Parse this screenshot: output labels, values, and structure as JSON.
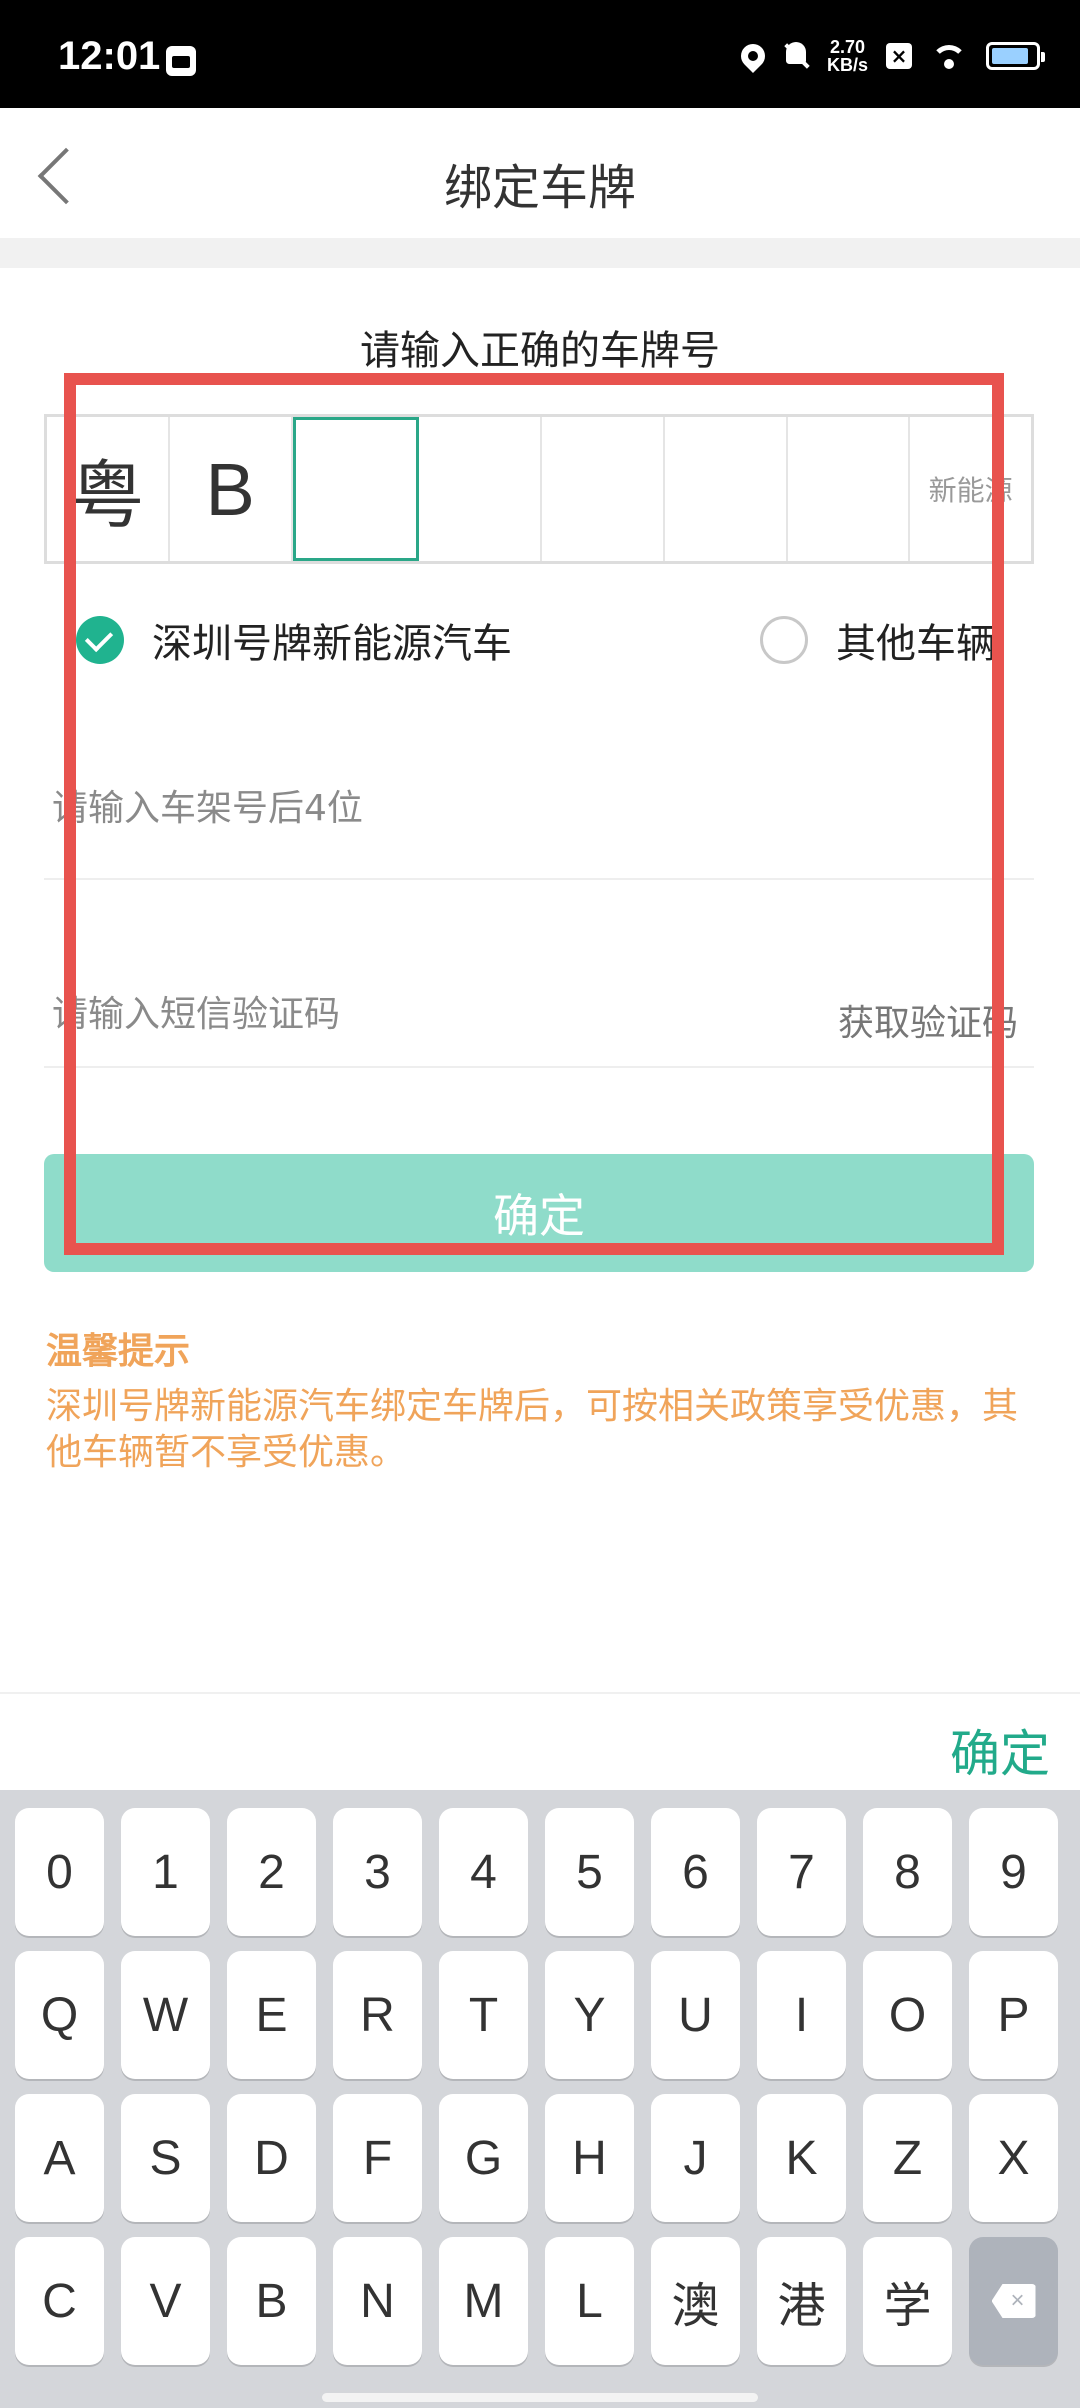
{
  "status_bar": {
    "time": "12:01",
    "speed": "2.70\nKB/s",
    "battery_level": 0.85
  },
  "header": {
    "title": "绑定车牌"
  },
  "form": {
    "heading": "请输入正确的车牌号",
    "plate_cells": [
      "粤",
      "B",
      "",
      "",
      "",
      "",
      "",
      "新能源"
    ],
    "radio_options": [
      {
        "label": "深圳号牌新能源汽车",
        "selected": true
      },
      {
        "label": "其他车辆",
        "selected": false
      }
    ],
    "vin_placeholder": "请输入车架号后4位",
    "sms_placeholder": "请输入短信验证码",
    "get_code_label": "获取验证码",
    "confirm_label": "确定"
  },
  "tips": {
    "title": "温馨提示",
    "body": "深圳号牌新能源汽车绑定车牌后，可按相关政策享受优惠，其他车辆暂不享受优惠。"
  },
  "keyboard": {
    "done_label": "确定",
    "rows": [
      [
        "0",
        "1",
        "2",
        "3",
        "4",
        "5",
        "6",
        "7",
        "8",
        "9"
      ],
      [
        "Q",
        "W",
        "E",
        "R",
        "T",
        "Y",
        "U",
        "I",
        "O",
        "P"
      ],
      [
        "A",
        "S",
        "D",
        "F",
        "G",
        "H",
        "J",
        "K",
        "Z",
        "X"
      ],
      [
        "C",
        "V",
        "B",
        "N",
        "M",
        "L",
        "澳",
        "港",
        "学"
      ]
    ],
    "delete_icon": "backspace-icon"
  },
  "colors": {
    "accent": "#20b38f",
    "button": "#8fdcca",
    "tip": "#f0a45a",
    "highlight_box": "#e8534e"
  }
}
